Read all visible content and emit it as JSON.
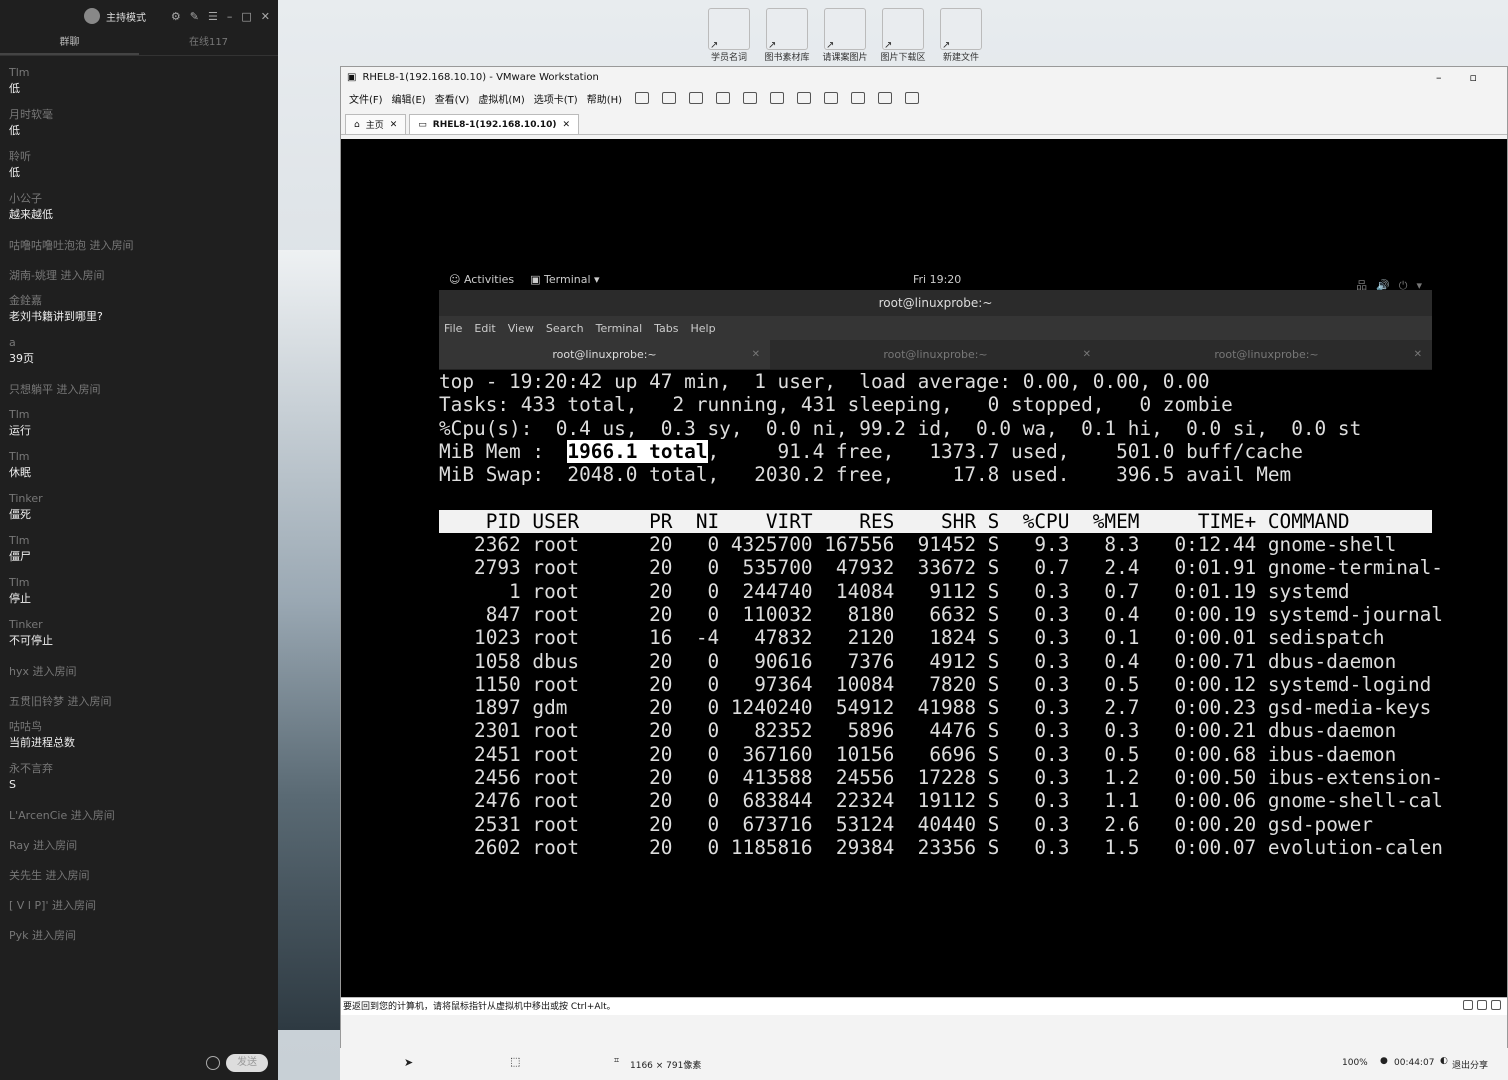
{
  "chat": {
    "mode_label": "主持模式",
    "tabs": [
      "群聊",
      "在线117"
    ],
    "messages": [
      {
        "name": "Tlm",
        "text": "低"
      },
      {
        "name": "月时软毫",
        "text": "低"
      },
      {
        "name": "聆听",
        "text": "低"
      },
      {
        "name": "小公子",
        "text": "越来越低"
      },
      {
        "sys": "咕噜咕噜吐泡泡 进入房间"
      },
      {
        "sys": "湖南-姚理 进入房间"
      },
      {
        "name": "金銓嘉",
        "text": "老刘书籍讲到哪里?"
      },
      {
        "name": "a",
        "text": "39页"
      },
      {
        "sys": "只想躺平 进入房间"
      },
      {
        "name": "Tlm",
        "text": "运行"
      },
      {
        "name": "Tlm",
        "text": "休眠"
      },
      {
        "name": "Tinker",
        "text": "僵死"
      },
      {
        "name": "Tlm",
        "text": "僵尸"
      },
      {
        "name": "Tlm",
        "text": "停止"
      },
      {
        "name": "Tinker",
        "text": "不可停止"
      },
      {
        "sys": "hyx 进入房间"
      },
      {
        "sys": "五贯旧铃梦 进入房间"
      },
      {
        "name": "咕咕鸟",
        "text": "当前进程总数"
      },
      {
        "name": "永不言弃",
        "text": "S"
      },
      {
        "sys": "L'ArcenCie 进入房间"
      },
      {
        "sys": "Ray 进入房间"
      },
      {
        "sys": "关先生 进入房间"
      },
      {
        "sys": "[ V I P]' 进入房间"
      },
      {
        "sys": "Pyk 进入房间"
      }
    ],
    "send_label": "发送"
  },
  "desktop_icons": [
    "学员名词",
    "图书素材库",
    "请课案图片",
    "图片下载区",
    "新建文件"
  ],
  "vmware": {
    "title": "RHEL8-1(192.168.10.10) - VMware Workstation",
    "menu": [
      "文件(F)",
      "编辑(E)",
      "查看(V)",
      "虚拟机(M)",
      "选项卡(T)",
      "帮助(H)"
    ],
    "tabs": [
      "主页",
      "RHEL8-1(192.168.10.10)"
    ],
    "status_text": "要返回到您的计算机，请将鼠标指针从虚拟机中移出或按 Ctrl+Alt。"
  },
  "recorder": {
    "size": "1166 × 791像素",
    "zoom": "100%",
    "time": "00:44:07",
    "exit": "退出分享"
  },
  "gnome": {
    "activities": "Activities",
    "app": "Terminal ▾",
    "clock": "Fri 19:20"
  },
  "terminal": {
    "title": "root@linuxprobe:~",
    "menu": [
      "File",
      "Edit",
      "View",
      "Search",
      "Terminal",
      "Tabs",
      "Help"
    ],
    "tabs": [
      "root@linuxprobe:~",
      "root@linuxprobe:~",
      "root@linuxprobe:~"
    ],
    "summary": [
      "top - 19:20:42 up 47 min,  1 user,  load average: 0.00, 0.00, 0.00",
      "Tasks: 433 total,   2 running, 431 sleeping,   0 stopped,   0 zombie",
      "%Cpu(s):  0.4 us,  0.3 sy,  0.0 ni, 99.2 id,  0.0 wa,  0.1 hi,  0.0 si,  0.0 st",
      "MiB Mem :  1966.1 total,     91.4 free,   1373.7 used,    501.0 buff/cache",
      "MiB Swap:  2048.0 total,   2030.2 free,     17.8 used.    396.5 avail Mem"
    ],
    "header": "    PID USER      PR  NI    VIRT    RES    SHR S  %CPU  %MEM     TIME+ COMMAND",
    "processes": [
      "   2362 root      20   0 4325700 167556  91452 S   9.3   8.3   0:12.44 gnome-shell",
      "   2793 root      20   0  535700  47932  33672 S   0.7   2.4   0:01.91 gnome-terminal-",
      "      1 root      20   0  244740  14084   9112 S   0.3   0.7   0:01.19 systemd",
      "    847 root      20   0  110032   8180   6632 S   0.3   0.4   0:00.19 systemd-journal",
      "   1023 root      16  -4   47832   2120   1824 S   0.3   0.1   0:00.01 sedispatch",
      "   1058 dbus      20   0   90616   7376   4912 S   0.3   0.4   0:00.71 dbus-daemon",
      "   1150 root      20   0   97364  10084   7820 S   0.3   0.5   0:00.12 systemd-logind",
      "   1897 gdm       20   0 1240240  54912  41988 S   0.3   2.7   0:00.23 gsd-media-keys",
      "   2301 root      20   0   82352   5896   4476 S   0.3   0.3   0:00.21 dbus-daemon",
      "   2451 root      20   0  367160  10156   6696 S   0.3   0.5   0:00.68 ibus-daemon",
      "   2456 root      20   0  413588  24556  17228 S   0.3   1.2   0:00.50 ibus-extension-",
      "   2476 root      20   0  683844  22324  19112 S   0.3   1.1   0:00.06 gnome-shell-cal",
      "   2531 root      20   0  673716  53124  40440 S   0.3   2.6   0:00.20 gsd-power",
      "   2602 root      20   0 1185816  29384  23356 S   0.3   1.5   0:00.07 evolution-calen"
    ]
  }
}
